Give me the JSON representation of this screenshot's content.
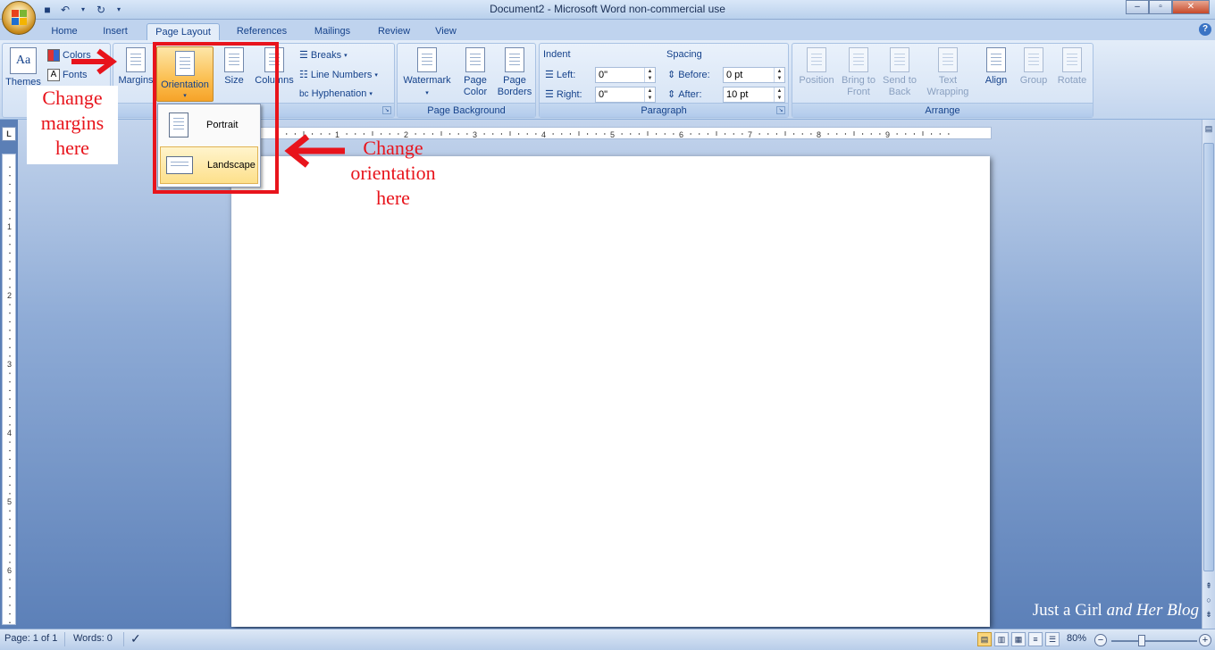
{
  "window": {
    "title": "Document2 - Microsoft Word non-commercial use"
  },
  "tabs": [
    "Home",
    "Insert",
    "Page Layout",
    "References",
    "Mailings",
    "Review",
    "View"
  ],
  "active_tab": "Page Layout",
  "ribbon": {
    "themes": {
      "themes_label": "Themes",
      "colors_label": "Colors",
      "fonts_label": "Fonts"
    },
    "page_setup": {
      "margins_label": "Margins",
      "orientation_label": "Orientation",
      "size_label": "Size",
      "columns_label": "Columns",
      "breaks_label": "Breaks",
      "line_numbers_label": "Line Numbers",
      "hyphenation_label": "Hyphenation",
      "group_label_fragment": "up"
    },
    "page_background": {
      "watermark_label": "Watermark",
      "page_color_line1": "Page",
      "page_color_line2": "Color",
      "page_borders_line1": "Page",
      "page_borders_line2": "Borders",
      "group_label": "Page Background"
    },
    "paragraph": {
      "indent_label": "Indent",
      "left_label": "Left:",
      "left_value": "0\"",
      "right_label": "Right:",
      "right_value": "0\"",
      "spacing_label": "Spacing",
      "before_label": "Before:",
      "before_value": "0 pt",
      "after_label": "After:",
      "after_value": "10 pt",
      "group_label": "Paragraph"
    },
    "arrange": {
      "position_label": "Position",
      "bring_line1": "Bring to",
      "bring_line2": "Front",
      "send_line1": "Send to",
      "send_line2": "Back",
      "text_line1": "Text",
      "text_line2": "Wrapping",
      "align_label": "Align",
      "group_btn_label": "Group",
      "rotate_label": "Rotate",
      "group_label": "Arrange"
    }
  },
  "orientation_menu": {
    "portrait": "Portrait",
    "landscape": "Landscape",
    "selected": "Landscape"
  },
  "annotations": {
    "margins_line1": "Change",
    "margins_line2": "margins",
    "margins_line3": "here",
    "orient_line1": "Change",
    "orient_line2": "orientation",
    "orient_line3": "here",
    "color": "#e8141c"
  },
  "ruler": {
    "corner": "L",
    "h_numbers": [
      "1",
      "2",
      "3",
      "4",
      "5",
      "6",
      "7",
      "8",
      "9"
    ],
    "v_numbers": [
      "1",
      "2",
      "3",
      "4",
      "5",
      "6"
    ]
  },
  "watermark": {
    "part1": "Just a Girl ",
    "part2": "and Her Blog"
  },
  "status": {
    "page": "Page: 1 of 1",
    "words": "Words: 0",
    "zoom": "80%"
  },
  "colors": {
    "ribbon_text": "#15428b",
    "workspace": "#5b7fb6",
    "highlight": "#fbbf51"
  }
}
